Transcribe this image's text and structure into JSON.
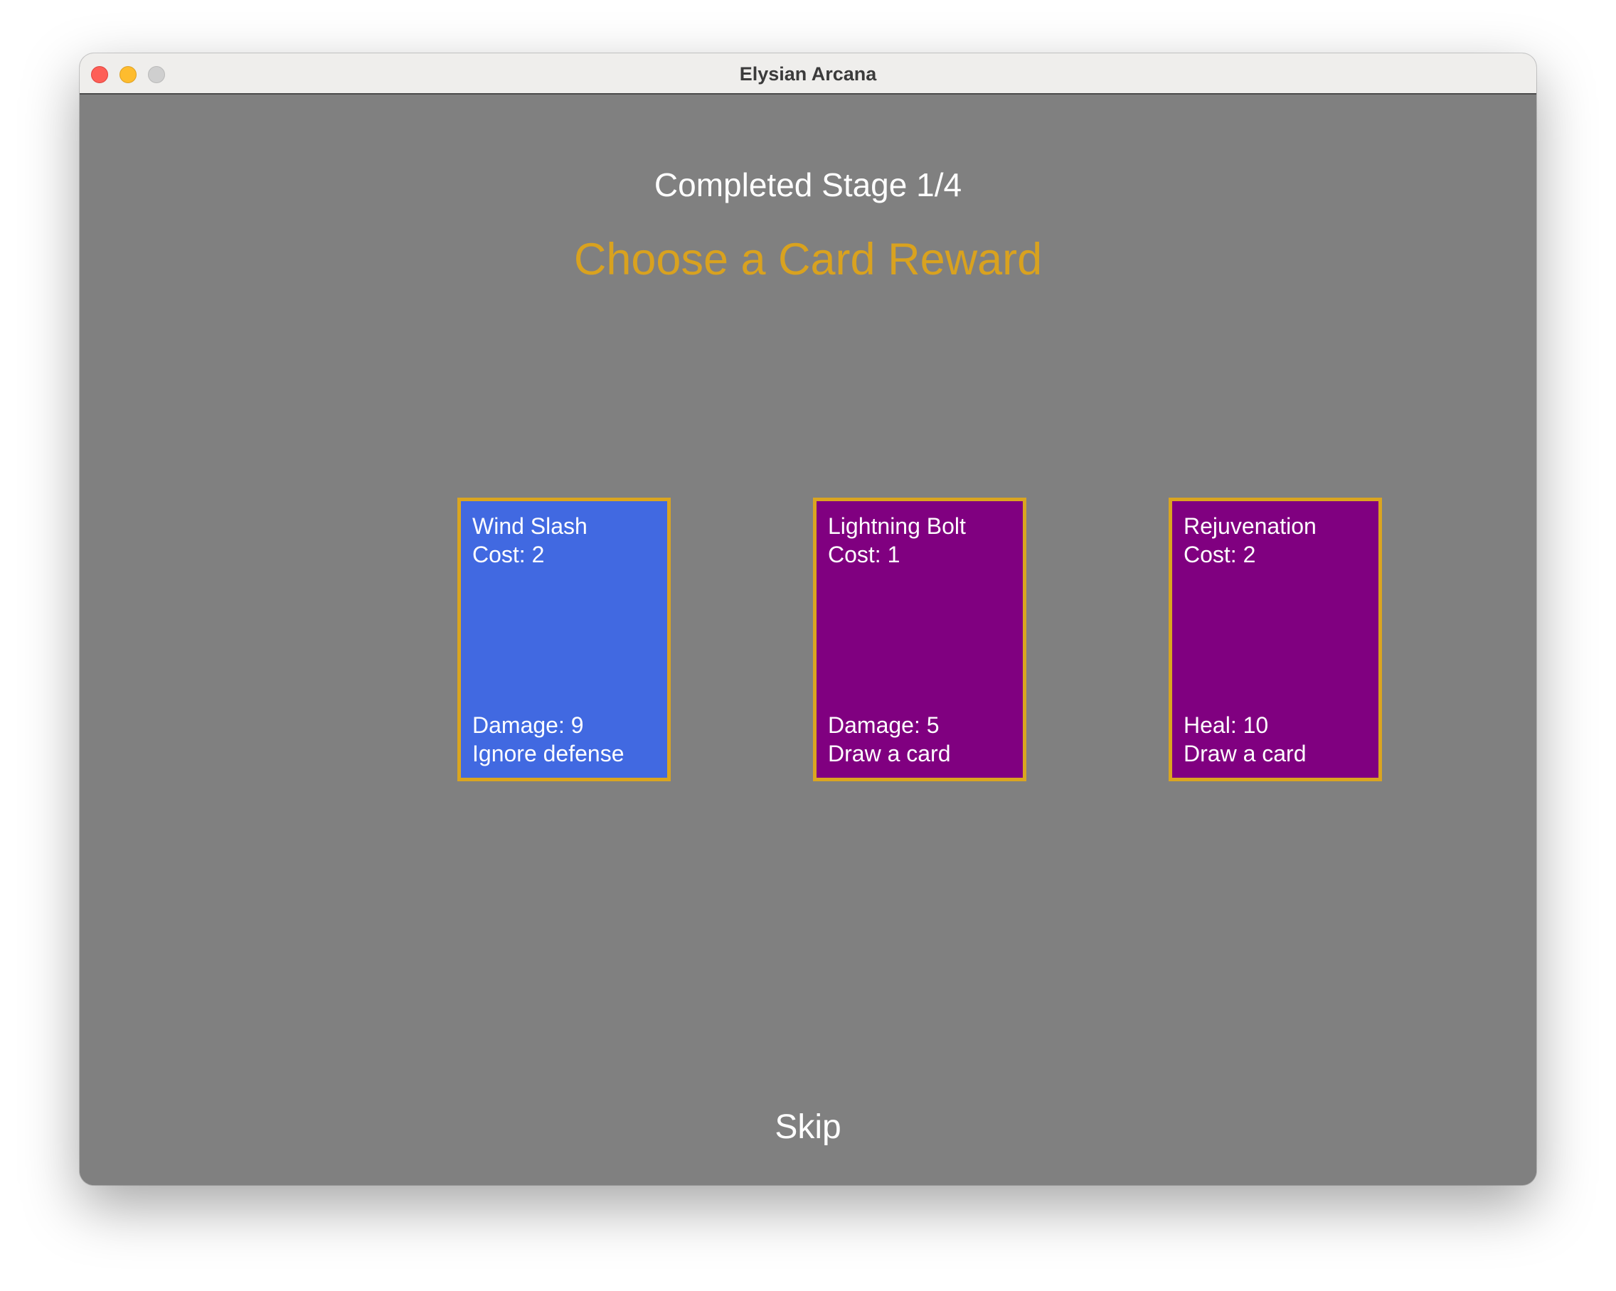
{
  "window": {
    "title": "Elysian Arcana"
  },
  "header": {
    "stage_text": "Completed Stage 1/4",
    "reward_prompt": "Choose a Card Reward"
  },
  "cards": [
    {
      "name": "Wind Slash",
      "cost": "Cost: 2",
      "effect_1": "Damage: 9",
      "effect_2": "Ignore defense",
      "color": "#4169e1"
    },
    {
      "name": "Lightning Bolt",
      "cost": "Cost: 1",
      "effect_1": "Damage: 5",
      "effect_2": "Draw a card",
      "color": "#800080"
    },
    {
      "name": "Rejuvenation",
      "cost": "Cost: 2",
      "effect_1": "Heal: 10",
      "effect_2": "Draw a card",
      "color": "#800080"
    }
  ],
  "footer": {
    "skip_label": "Skip"
  },
  "colors": {
    "background": "#808080",
    "accent_gold": "#daa520",
    "text": "#ffffff"
  }
}
